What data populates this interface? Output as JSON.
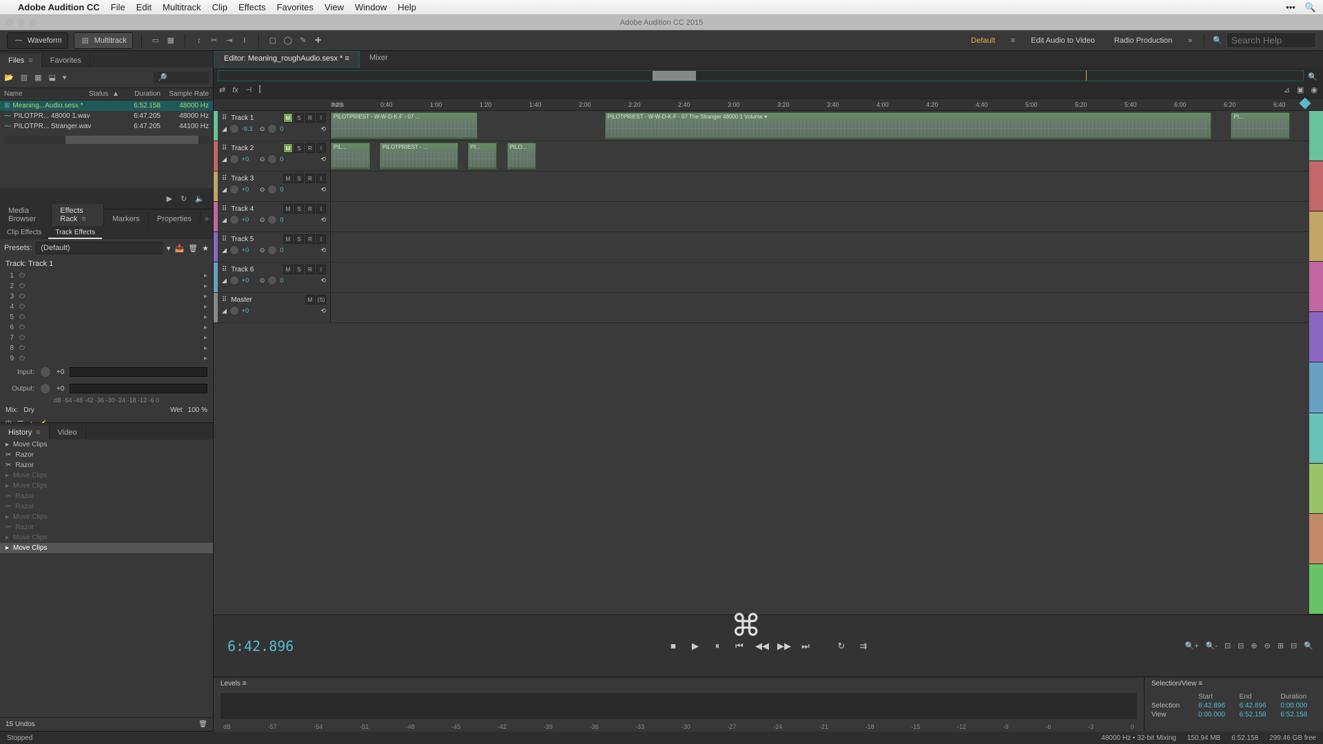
{
  "macmenu": {
    "app": "Adobe Audition CC",
    "items": [
      "File",
      "Edit",
      "Multitrack",
      "Clip",
      "Effects",
      "Favorites",
      "View",
      "Window",
      "Help"
    ]
  },
  "winbar": {
    "title": "Adobe Audition CC 2015"
  },
  "toolbar": {
    "waveform": "Waveform",
    "multitrack": "Multitrack",
    "workspaces": {
      "default": "Default",
      "editav": "Edit Audio to Video",
      "radio": "Radio Production"
    },
    "search_ph": "Search Help"
  },
  "files_panel": {
    "tab_files": "Files",
    "tab_fav": "Favorites",
    "headers": {
      "name": "Name",
      "status": "Status",
      "duration": "Duration",
      "sample": "Sample Rate"
    },
    "rows": [
      {
        "name": "Meaning...Audio.sesx *",
        "dur": "6:52.158",
        "sr": "48000 Hz",
        "sel": true,
        "icon": "⊞"
      },
      {
        "name": "PILOTPR... 48000 1.wav",
        "dur": "6:47.205",
        "sr": "48000 Hz",
        "sel": false,
        "icon": "⁓"
      },
      {
        "name": "PILOTPR... Stranger.wav",
        "dur": "6:47.205",
        "sr": "44100 Hz",
        "sel": false,
        "icon": "⁓"
      }
    ]
  },
  "left_tabs": {
    "media": "Media Browser",
    "effects": "Effects Rack",
    "markers": "Markers",
    "props": "Properties"
  },
  "effects": {
    "subtabs": {
      "clip": "Clip Effects",
      "track": "Track Effects"
    },
    "presets_lbl": "Presets:",
    "preset_val": "(Default)",
    "track_lbl": "Track: Track 1",
    "slots": [
      1,
      2,
      3,
      4,
      5,
      6,
      7,
      8,
      9
    ],
    "input_lbl": "Input:",
    "output_lbl": "Output:",
    "gain": "+0",
    "dbscale": "dB   -54  -48  -42  -36  -30  -24  -18  -12   -6    0",
    "mix_lbl": "Mix:",
    "dry": "Dry",
    "wet": "Wet",
    "wet_val": "100 %"
  },
  "hist": {
    "tab_hist": "History",
    "tab_vid": "Video",
    "items": [
      {
        "t": "Move Clips",
        "k": "▸"
      },
      {
        "t": "Razor",
        "k": "✂"
      },
      {
        "t": "Razor",
        "k": "✂"
      },
      {
        "t": "Move Clips",
        "k": "▸",
        "fut": true
      },
      {
        "t": "Move Clips",
        "k": "▸",
        "fut": true
      },
      {
        "t": "Razor",
        "k": "✂",
        "fut": true
      },
      {
        "t": "Razor",
        "k": "✂",
        "fut": true
      },
      {
        "t": "Move Clips",
        "k": "▸",
        "fut": true
      },
      {
        "t": "Razor",
        "k": "✂",
        "fut": true
      },
      {
        "t": "Move Clips",
        "k": "▸",
        "fut": true
      },
      {
        "t": "Move Clips",
        "k": "▸",
        "cur": true
      }
    ],
    "undos": "15 Undos"
  },
  "editor": {
    "tab_editor": "Editor: Meaning_roughAudio.sesx *",
    "tab_mixer": "Mixer",
    "hms": "hms",
    "ticks": [
      "0:20",
      "0:40",
      "1:00",
      "1:20",
      "1:40",
      "2:00",
      "2:20",
      "2:40",
      "3:00",
      "3:20",
      "3:40",
      "4:00",
      "4:20",
      "4:40",
      "5:00",
      "5:20",
      "5:40",
      "6:00",
      "6:20",
      "6:40"
    ]
  },
  "tracks": [
    {
      "name": "Track 1",
      "color": "#68c29a",
      "m": true,
      "gain": "-9.3",
      "pan": "0",
      "clips": [
        {
          "l": 0,
          "w": 15,
          "t": "PILOTPRIEST - W-W-D-K-F - 07 ..."
        },
        {
          "l": 28,
          "w": 62,
          "t": "PILOTPRIEST - W-W-D-K-F - 07 The Stranger 48000 1                                                         Volume ▾"
        },
        {
          "l": 92,
          "w": 6,
          "t": "PI..."
        }
      ]
    },
    {
      "name": "Track 2",
      "color": "#c26868",
      "m": true,
      "gain": "+0",
      "pan": "0",
      "clips": [
        {
          "l": 0,
          "w": 4,
          "t": "PIL..."
        },
        {
          "l": 5,
          "w": 8,
          "t": "PILOTPRIEST - ..."
        },
        {
          "l": 14,
          "w": 3,
          "t": "PI..."
        },
        {
          "l": 18,
          "w": 3,
          "t": "PILO..."
        }
      ]
    },
    {
      "name": "Track 3",
      "color": "#c2a668",
      "gain": "+0",
      "pan": "0",
      "clips": []
    },
    {
      "name": "Track 4",
      "color": "#c268a0",
      "gain": "+0",
      "pan": "0",
      "clips": []
    },
    {
      "name": "Track 5",
      "color": "#8a68c2",
      "gain": "+0",
      "pan": "0",
      "clips": []
    },
    {
      "name": "Track 6",
      "color": "#68a0c2",
      "gain": "+0",
      "pan": "0",
      "clips": []
    }
  ],
  "master": {
    "name": "Master",
    "gain": "+0"
  },
  "transport": {
    "time": "6:42.896"
  },
  "levels": {
    "label": "Levels",
    "ticks": [
      "dB",
      "-57",
      "-54",
      "-51",
      "-48",
      "-45",
      "-42",
      "-39",
      "-36",
      "-33",
      "-30",
      "-27",
      "-24",
      "-21",
      "-18",
      "-15",
      "-12",
      "-9",
      "-6",
      "-3",
      "0"
    ]
  },
  "selview": {
    "label": "Selection/View",
    "hdr": {
      "start": "Start",
      "end": "End",
      "dur": "Duration"
    },
    "sel_lbl": "Selection",
    "sel": [
      "6:42.896",
      "6:42.896",
      "0:00.000"
    ],
    "view_lbl": "View",
    "view": [
      "0:00.000",
      "6:52.158",
      "6:52.158"
    ]
  },
  "status": {
    "state": "Stopped",
    "fmt": "48000 Hz • 32-bit Mixing",
    "mem": "150.94 MB",
    "dur": "6:52.158",
    "free": "299.46 GB free"
  },
  "right_colors": [
    "#68c29a",
    "#c26868",
    "#c2a668",
    "#c268a0",
    "#8a68c2",
    "#68a0c2",
    "#68c2b8",
    "#9ac268",
    "#c28a68",
    "#68c268"
  ]
}
